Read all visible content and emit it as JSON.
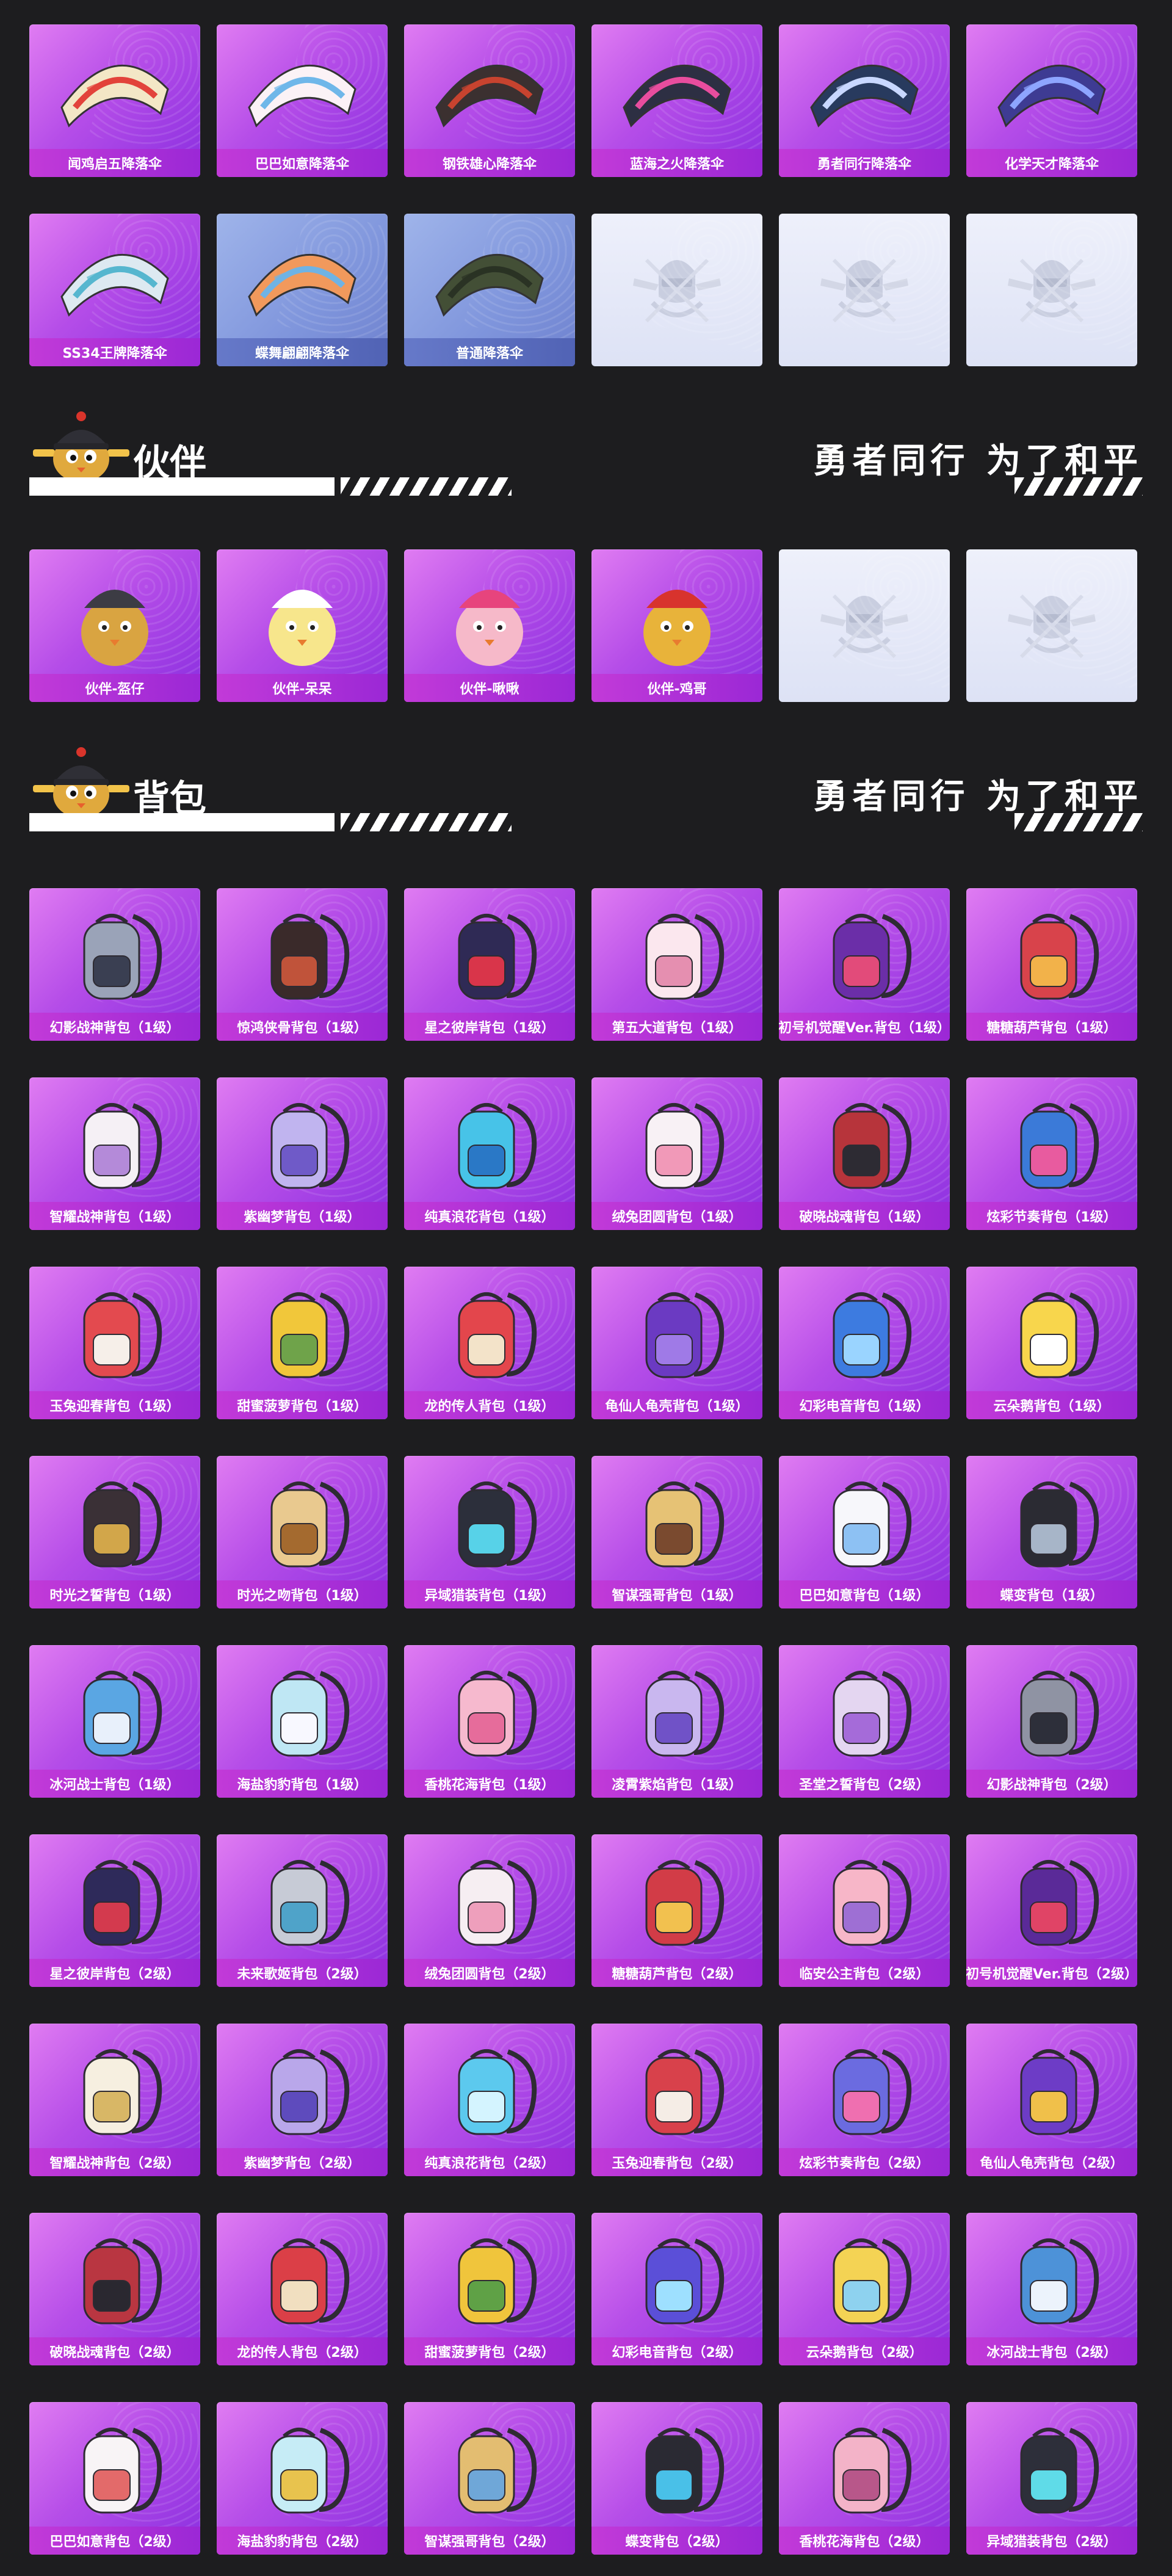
{
  "parachutes": [
    {
      "label": "闻鸡启五降落伞",
      "style": "pink",
      "color": "#f3e7c6",
      "accent": "#e2433b"
    },
    {
      "label": "巴巴如意降落伞",
      "style": "pink",
      "color": "#fbf2f6",
      "accent": "#6fb7e9"
    },
    {
      "label": "钢铁雄心降落伞",
      "style": "pink",
      "color": "#3b3030",
      "accent": "#c7432f"
    },
    {
      "label": "蓝海之火降落伞",
      "style": "pink",
      "color": "#2d2f43",
      "accent": "#e84d9e"
    },
    {
      "label": "勇者同行降落伞",
      "style": "pink",
      "color": "#283a5e",
      "accent": "#c8d7ff"
    },
    {
      "label": "化学天才降落伞",
      "style": "pink",
      "color": "#3e3b93",
      "accent": "#8ea5ff"
    },
    {
      "label": "SS34王牌降落伞",
      "style": "pink",
      "color": "#dde9f1",
      "accent": "#56b6cf"
    },
    {
      "label": "蝶舞翩翩降落伞",
      "style": "blue",
      "color": "#f1995c",
      "accent": "#6fb3e4"
    },
    {
      "label": "普通降落伞",
      "style": "blue",
      "color": "#434f36",
      "accent": "#2a3224"
    },
    {
      "label": "",
      "style": "empty"
    },
    {
      "label": "",
      "style": "empty"
    },
    {
      "label": "",
      "style": "empty"
    }
  ],
  "sections": {
    "companion": {
      "title": "伙伴",
      "slogan": "勇者同行 为了和平"
    },
    "backpack": {
      "title": "背包",
      "slogan": "勇者同行 为了和平"
    }
  },
  "companions": [
    {
      "label": "伙伴-盔仔",
      "style": "pink",
      "color": "#d9a441",
      "accent": "#3c3c44"
    },
    {
      "label": "伙伴-呆呆",
      "style": "pink",
      "color": "#f7e68c",
      "accent": "#ffffff"
    },
    {
      "label": "伙伴-啾啾",
      "style": "pink",
      "color": "#f6b9c9",
      "accent": "#e7447d"
    },
    {
      "label": "伙伴-鸡哥",
      "style": "pink",
      "color": "#e8b33a",
      "accent": "#d8332d"
    },
    {
      "label": "",
      "style": "empty"
    },
    {
      "label": "",
      "style": "empty"
    }
  ],
  "backpacks": [
    {
      "label": "幻影战神背包（1级）",
      "color": "#9aa3b8",
      "accent": "#3a3f52"
    },
    {
      "label": "惊鸿侠骨背包（1级）",
      "color": "#3a2a2a",
      "accent": "#c0533a"
    },
    {
      "label": "星之彼岸背包（1级）",
      "color": "#2f2a55",
      "accent": "#d9354a"
    },
    {
      "label": "第五大道背包（1级）",
      "color": "#fbe7ee",
      "accent": "#e58fb0"
    },
    {
      "label": "初号机觉醒Ver.背包（1级）",
      "color": "#6b2ea8",
      "accent": "#e24b7a"
    },
    {
      "label": "糖糖葫芦背包（1级）",
      "color": "#d8434b",
      "accent": "#f2b24a"
    },
    {
      "label": "智耀战神背包（1级）",
      "color": "#f5f0f5",
      "accent": "#b48ad9"
    },
    {
      "label": "紫幽梦背包（1级）",
      "color": "#c0b4ef",
      "accent": "#6f5ac8"
    },
    {
      "label": "纯真浪花背包（1级）",
      "color": "#47c3e8",
      "accent": "#2a78c6"
    },
    {
      "label": "绒兔团圆背包（1级）",
      "color": "#f8f1f5",
      "accent": "#f199b8"
    },
    {
      "label": "破晓战魂背包（1级）",
      "color": "#b7343b",
      "accent": "#2d2b33"
    },
    {
      "label": "炫彩节奏背包（1级）",
      "color": "#3b7ad8",
      "accent": "#e85b9f"
    },
    {
      "label": "玉兔迎春背包（1级）",
      "color": "#e34a4f",
      "accent": "#f6efe9"
    },
    {
      "label": "甜蜜菠萝背包（1级）",
      "color": "#f1c73a",
      "accent": "#6fa34a"
    },
    {
      "label": "龙的传人背包（1级）",
      "color": "#e3464c",
      "accent": "#f3e3c9"
    },
    {
      "label": "龟仙人龟壳背包（1级）",
      "color": "#6b3ac2",
      "accent": "#9f7ae7"
    },
    {
      "label": "幻彩电音背包（1级）",
      "color": "#3d7be0",
      "accent": "#9ad4ff"
    },
    {
      "label": "云朵鹅背包（1级）",
      "color": "#f8d64c",
      "accent": "#ffffff"
    },
    {
      "label": "时光之誓背包（1级）",
      "color": "#3a3036",
      "accent": "#d2a64a"
    },
    {
      "label": "时光之吻背包（1级）",
      "color": "#e9c98f",
      "accent": "#a46a2f"
    },
    {
      "label": "异域猎装背包（1级）",
      "color": "#2c2f3b",
      "accent": "#57d2e8"
    },
    {
      "label": "智谋强哥背包（1级）",
      "color": "#e6c275",
      "accent": "#7a4a2f"
    },
    {
      "label": "巴巴如意背包（1级）",
      "color": "#f7f7fb",
      "accent": "#8dc1f3"
    },
    {
      "label": "蝶变背包（1级）",
      "color": "#2b2b33",
      "accent": "#a7b5c8"
    },
    {
      "label": "冰河战士背包（1级）",
      "color": "#5aa6e3",
      "accent": "#e8f0fb"
    },
    {
      "label": "海盐豹豹背包（1级）",
      "color": "#bfe7f4",
      "accent": "#f8f8ff"
    },
    {
      "label": "香桃花海背包（1级）",
      "color": "#f6b9ce",
      "accent": "#e66c9b"
    },
    {
      "label": "凌霄紫焰背包（1级）",
      "color": "#c9b7ef",
      "accent": "#7052c7"
    },
    {
      "label": "圣堂之誓背包（2级）",
      "color": "#e4d6f1",
      "accent": "#a56bd9"
    },
    {
      "label": "幻影战神背包（2级）",
      "color": "#8f93a3",
      "accent": "#2d2f3a"
    },
    {
      "label": "星之彼岸背包（2级）",
      "color": "#2e2a5a",
      "accent": "#d33a4e"
    },
    {
      "label": "未来歌姬背包（2级）",
      "color": "#c7cbd6",
      "accent": "#4fa3c9"
    },
    {
      "label": "绒兔团圆背包（2级）",
      "color": "#f6eef2",
      "accent": "#ee9fbc"
    },
    {
      "label": "糖糖葫芦背包（2级）",
      "color": "#d23c47",
      "accent": "#f2c14f"
    },
    {
      "label": "临安公主背包（2级）",
      "color": "#f7b6c8",
      "accent": "#9e6fd4"
    },
    {
      "label": "初号机觉醒Ver.背包（2级）",
      "color": "#5a2a98",
      "accent": "#e04466"
    },
    {
      "label": "智耀战神背包（2级）",
      "color": "#f6efe0",
      "accent": "#d8b766"
    },
    {
      "label": "紫幽梦背包（2级）",
      "color": "#b9a7ea",
      "accent": "#5e4bbd"
    },
    {
      "label": "纯真浪花背包（2级）",
      "color": "#5cc9ee",
      "accent": "#d4f4ff"
    },
    {
      "label": "玉兔迎春背包（2级）",
      "color": "#d8414b",
      "accent": "#f5ede6"
    },
    {
      "label": "炫彩节奏背包（2级）",
      "color": "#6b6be0",
      "accent": "#ef6fb0"
    },
    {
      "label": "龟仙人龟壳背包（2级）",
      "color": "#6d3cc6",
      "accent": "#f0c04a"
    },
    {
      "label": "破晓战魂背包（2级）",
      "color": "#b93641",
      "accent": "#2a2830"
    },
    {
      "label": "龙的传人背包（2级）",
      "color": "#db3f47",
      "accent": "#f1dfc0"
    },
    {
      "label": "甜蜜菠萝背包（2级）",
      "color": "#f0c53c",
      "accent": "#5fa146"
    },
    {
      "label": "幻彩电音背包（2级）",
      "color": "#5b4fd8",
      "accent": "#9ee0ff"
    },
    {
      "label": "云朵鹅背包（2级）",
      "color": "#f4d354",
      "accent": "#8ed2ef"
    },
    {
      "label": "冰河战士背包（2级）",
      "color": "#4d92d8",
      "accent": "#ecf3fc"
    },
    {
      "label": "巴巴如意背包（2级）",
      "color": "#f8f4f6",
      "accent": "#e36a6a"
    },
    {
      "label": "海盐豹豹背包（2级）",
      "color": "#c6ecf6",
      "accent": "#e8c34e"
    },
    {
      "label": "智谋强哥背包（2级）",
      "color": "#e3bd71",
      "accent": "#6fa7d8"
    },
    {
      "label": "蝶变背包（2级）",
      "color": "#2a2a33",
      "accent": "#49c0e8"
    },
    {
      "label": "香桃花海背包（2级）",
      "color": "#f3b3c8",
      "accent": "#b8578a"
    },
    {
      "label": "异域猎装背包（2级）",
      "color": "#2d2f3a",
      "accent": "#5fdbe8"
    }
  ]
}
